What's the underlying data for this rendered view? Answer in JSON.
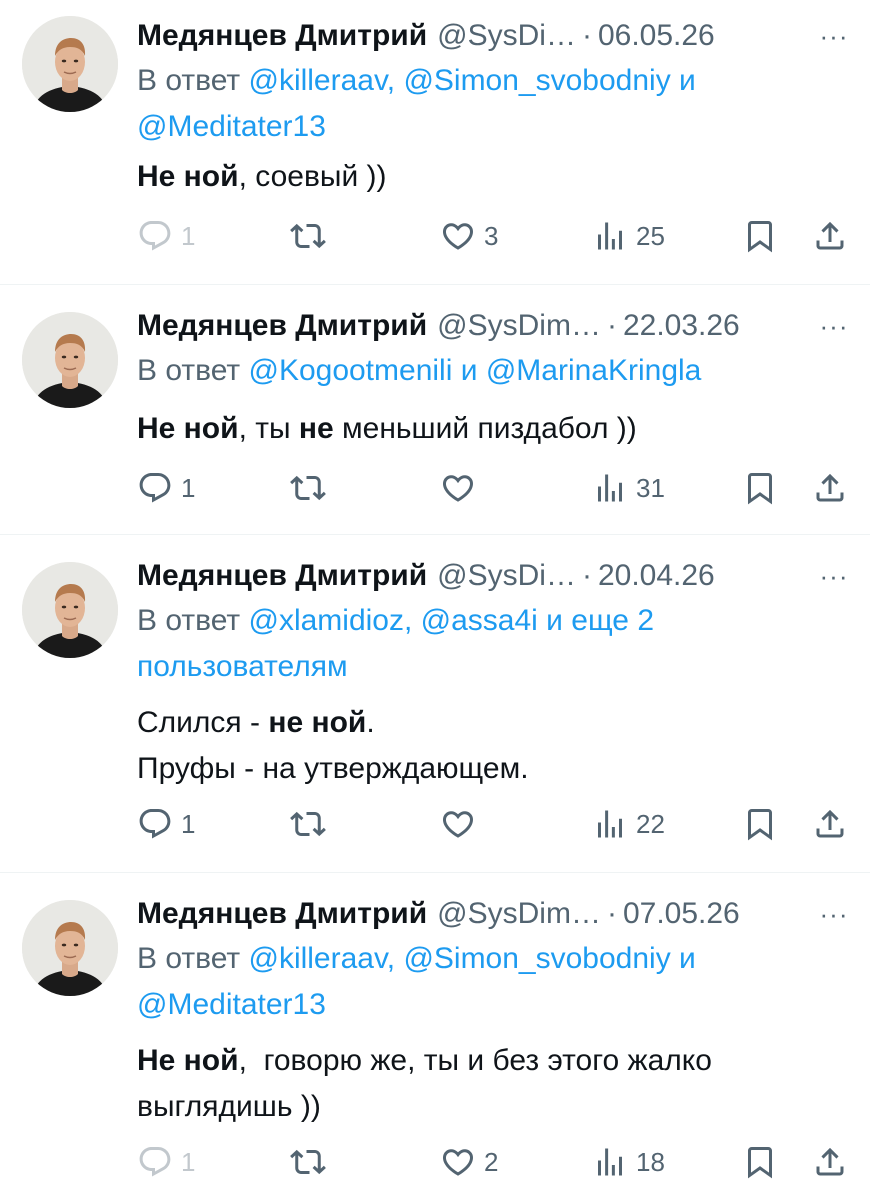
{
  "tweets": [
    {
      "name": "Медянцев Дмитрий",
      "handle": "@SysDi…",
      "date": "06.05.26",
      "more": "···",
      "reply_prefix": "В ответ ",
      "reply_links": [
        "@killeraav",
        "@Simon_svobodniy"
      ],
      "reply_sep1": ", ",
      "reply_and": " и",
      "reply_line2": "@Meditater13",
      "body_bold": "Не ной",
      "body_rest": ", соевый ))",
      "replies": "1",
      "likes": "3",
      "views": "25"
    },
    {
      "name": "Медянцев Дмитрий",
      "handle": "@SysDim…",
      "date": "22.03.26",
      "more": "···",
      "reply_prefix": "В ответ ",
      "reply_link1": "@Kogootmenili",
      "reply_and": " и ",
      "reply_link2": "@MarinaKringla",
      "body_bold1": "Не ной",
      "body_mid": ", ты ",
      "body_bold2": "не",
      "body_rest": " меньший пиздабол ))",
      "replies": "1",
      "likes": "",
      "views": "31"
    },
    {
      "name": "Медянцев Дмитрий",
      "handle": "@SysDi…",
      "date": "20.04.26",
      "more": "···",
      "reply_prefix": "В ответ ",
      "reply_link1": "@xlamidioz",
      "reply_sep": ", ",
      "reply_link2": "@assa4i",
      "reply_more": " и еще 2",
      "reply_line2": "пользователям",
      "body_line1_pre": "Слился - ",
      "body_line1_bold": "не ной",
      "body_line1_post": ".",
      "body_line2": "Пруфы - на утверждающем.",
      "replies": "1",
      "likes": "",
      "views": "22"
    },
    {
      "name": "Медянцев Дмитрий",
      "handle": "@SysDim…",
      "date": "07.05.26",
      "more": "···",
      "reply_prefix": "В ответ ",
      "reply_links": [
        "@killeraav",
        "@Simon_svobodniy"
      ],
      "reply_sep1": ", ",
      "reply_and": " и",
      "reply_line2": "@Meditater13",
      "body_bold": "Не ной",
      "body_rest": ",  говорю же, ты и без этого жалко",
      "body_line2": "выглядишь ))",
      "replies": "1",
      "likes": "2",
      "views": "18"
    }
  ],
  "icons": {
    "reply": "comment-bubble-icon",
    "retweet": "retweet-icon",
    "like": "heart-icon",
    "views": "bar-chart-icon",
    "bookmark": "bookmark-icon",
    "share": "share-upload-icon"
  },
  "colors": {
    "text": "#0f1419",
    "secondary": "#536471",
    "link": "#1d9bf0",
    "divider": "#eff3f4"
  }
}
